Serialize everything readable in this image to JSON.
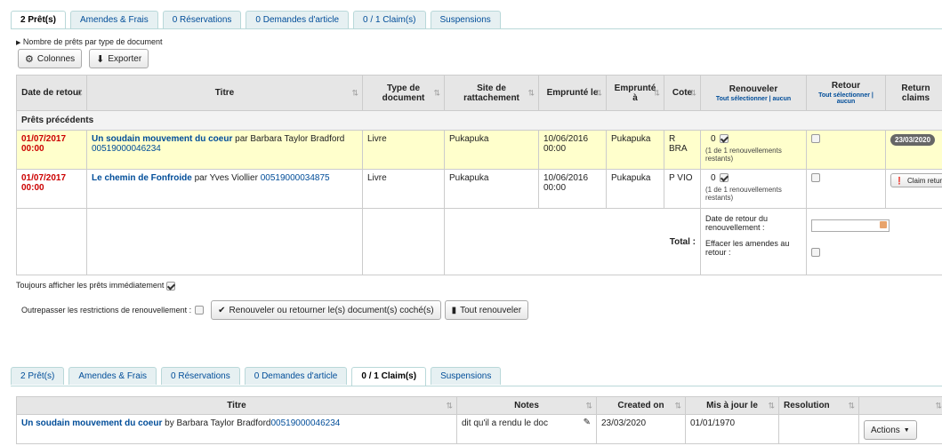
{
  "tabs_top": [
    {
      "label": "2 Prêt(s)",
      "active": true
    },
    {
      "label": "Amendes & Frais",
      "active": false
    },
    {
      "label": "0 Réservations",
      "active": false
    },
    {
      "label": "0 Demandes d'article",
      "active": false
    },
    {
      "label": "0 / 1 Claim(s)",
      "active": false
    },
    {
      "label": "Suspensions",
      "active": false
    }
  ],
  "checkouts": {
    "toggle_label": "Nombre de prêts par type de document",
    "columns_btn": "Colonnes",
    "export_btn": "Exporter",
    "headers": {
      "date_retour": "Date de retour",
      "titre": "Titre",
      "type_doc": "Type de document",
      "site": "Site de rattachement",
      "emprunte_le": "Emprunté le",
      "emprunte_a": "Emprunté à",
      "cote": "Cote",
      "renouveler": "Renouveler",
      "renouveler_sub": "Tout sélectionner | aucun",
      "retour": "Retour",
      "retour_sub": "Tout sélectionner | aucun",
      "return_claims": "Return claims"
    },
    "group_label": "Prêts précédents",
    "rows": [
      {
        "due": "01/07/2017 00:00",
        "title": "Un soudain mouvement du coeur",
        "by": "par Barbara Taylor Bradford",
        "barcode": "00519000046234",
        "type": "Livre",
        "site": "Pukapuka",
        "date": "10/06/2016 00:00",
        "from": "Pukapuka",
        "callno": "R BRA",
        "renew_count": "0",
        "renew_note": "(1 de 1 renouvellements restants)",
        "claim": "23/03/2020"
      },
      {
        "due": "01/07/2017 00:00",
        "title": "Le chemin de Fonfroide",
        "by": "par Yves Viollier",
        "barcode": "00519000034875",
        "type": "Livre",
        "site": "Pukapuka",
        "date": "10/06/2016 00:00",
        "from": "Pukapuka",
        "callno": "P VIO",
        "renew_count": "0",
        "renew_note": "(1 de 1 renouvellements restants)",
        "claim": "Claim returned"
      }
    ],
    "total_label": "Total :",
    "renew_date_label": "Date de retour du renouvellement :",
    "forgive_label": "Effacer les amendes au retour :"
  },
  "always_show_label": "Toujours afficher les prêts immédiatement",
  "override_label": "Outrepasser les restrictions de renouvellement :",
  "renew_checked_btn": "Renouveler ou retourner le(s) document(s) coché(s)",
  "renew_all_btn": "Tout renouveler",
  "tabs_bottom": [
    {
      "label": "2 Prêt(s)",
      "active": false
    },
    {
      "label": "Amendes & Frais",
      "active": false
    },
    {
      "label": "0 Réservations",
      "active": false
    },
    {
      "label": "0 Demandes d'article",
      "active": false
    },
    {
      "label": "0 / 1 Claim(s)",
      "active": true
    },
    {
      "label": "Suspensions",
      "active": false
    }
  ],
  "claims": {
    "headers": {
      "titre": "Titre",
      "notes": "Notes",
      "created": "Created on",
      "updated": "Mis à jour le",
      "resolution": "Resolution"
    },
    "row": {
      "title": "Un soudain mouvement du coeur",
      "by": "by Barbara Taylor Bradford",
      "barcode": "00519000046234",
      "notes": "dit qu'il a rendu le doc",
      "created": "23/03/2020",
      "updated": "01/01/1970",
      "actions": "Actions"
    }
  }
}
